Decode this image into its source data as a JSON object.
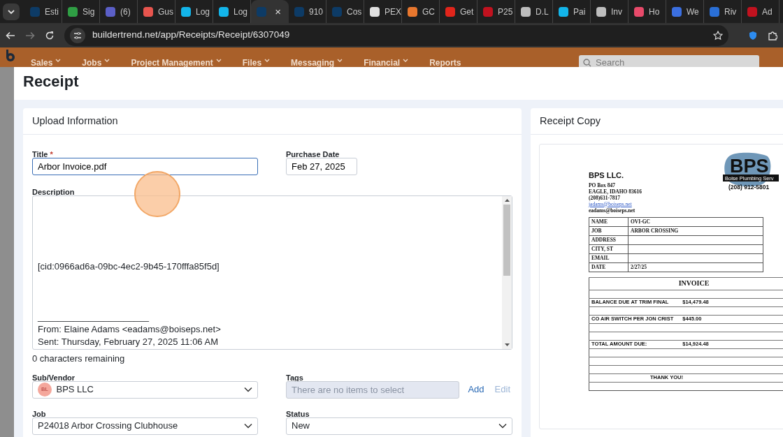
{
  "browser": {
    "tabs": [
      {
        "title": "Esti",
        "color": "#0d3b66",
        "selected": false
      },
      {
        "title": "Sig",
        "color": "#2f9e44",
        "selected": false
      },
      {
        "title": "(6)",
        "color": "#5b5fc7",
        "selected": false
      },
      {
        "title": "Gus",
        "color": "#e8554e",
        "selected": false
      },
      {
        "title": "Log",
        "color": "#13b5ea",
        "selected": false
      },
      {
        "title": "Log",
        "color": "#13b5ea",
        "selected": false
      },
      {
        "close": "×",
        "color": "#0d3b66",
        "selected": true
      },
      {
        "title": "910",
        "color": "#0d3b66",
        "selected": false
      },
      {
        "title": "Cos",
        "color": "#0d3b66",
        "selected": false
      },
      {
        "title": "PEX",
        "color": "#e0e0e0",
        "selected": false
      },
      {
        "title": "GC",
        "color": "#e8772e",
        "selected": false
      },
      {
        "title": "Get",
        "color": "#e1251b",
        "selected": false
      },
      {
        "title": "P25",
        "color": "#c1121f",
        "selected": false
      },
      {
        "title": "D.L",
        "color": "#bdbdbd",
        "selected": false
      },
      {
        "title": "Pai",
        "color": "#13b5ea",
        "selected": false
      },
      {
        "title": "Inv",
        "color": "#bdbdbd",
        "selected": false
      },
      {
        "title": "Ho",
        "color": "#e84a6a",
        "selected": false
      },
      {
        "title": "We",
        "color": "#3b6fe0",
        "selected": false
      },
      {
        "title": "Riv",
        "color": "#2a6fd6",
        "selected": false
      },
      {
        "title": "Ad",
        "color": "#c1121f",
        "selected": false
      }
    ],
    "url": "buildertrend.net/app/Receipts/Receipt/6307049"
  },
  "app_nav": {
    "items": [
      "Sales",
      "Jobs",
      "Project Management",
      "Files",
      "Messaging",
      "Financial",
      "Reports"
    ],
    "search_placeholder": "Search"
  },
  "modal": {
    "title": "Receipt",
    "upload": {
      "heading": "Upload Information",
      "title_field": {
        "label": "Title",
        "required_mark": "*",
        "value": "Arbor Invoice.pdf",
        "focused": true
      },
      "purchase_date": {
        "label": "Purchase Date",
        "value": "Feb 27, 2025"
      },
      "description": {
        "label": "Description",
        "value": "\n\n\n\n\n[cid:0966ad6a-09bc-4ec2-9b45-170fffa85f5d]\n\n\n\n______________________\nFrom: Elaine Adams <eadams@boiseps.net>\nSent: Thursday, February 27, 2025 11:06 AM"
      },
      "characters_remaining": "0 characters remaining",
      "sub_vendor": {
        "label": "Sub/Vendor",
        "avatar": "BL",
        "value": "BPS LLC"
      },
      "tags": {
        "label": "Tags",
        "placeholder": "There are no items to select",
        "add": "Add",
        "edit": "Edit",
        "edit_disabled": true
      },
      "job": {
        "label": "Job",
        "value": "P24018 Arbor Crossing Clubhouse"
      },
      "status": {
        "label": "Status",
        "value": "New"
      }
    },
    "receipt_copy": {
      "heading": "Receipt Copy",
      "document": {
        "logo": {
          "text": "BPS",
          "band": "Boise Plumbing Serv",
          "phone": "(208) 912-5801"
        },
        "company": "BPS LLC.",
        "address_lines": [
          "PO Box 847",
          "EAGLE, IDAHO 83616",
          "(208)631-7817"
        ],
        "link": "jadams@boiseps.net",
        "email": "eadams@boiseps.net",
        "info_rows": [
          {
            "label": "NAME",
            "value": "OVI-GC"
          },
          {
            "label": "JOB",
            "value": "ARBOR CROSSING"
          },
          {
            "label": "ADDRESS"
          },
          {
            "label": "CITY, ST"
          },
          {
            "label": "EMAIL"
          },
          {
            "label": "DATE",
            "value": "2/27/25"
          }
        ],
        "invoice": {
          "title": "INVOICE",
          "rows": [
            {
              "kind": "blank"
            },
            {
              "kind": "item",
              "label": "BALANCE DUE AT TRIM FINAL",
              "amount": "$14,479.48"
            },
            {
              "kind": "blank"
            },
            {
              "kind": "item",
              "label": "CO AIR SWITCH PER JON CRIST",
              "amount": "$445.00"
            },
            {
              "kind": "blank"
            },
            {
              "kind": "blank"
            },
            {
              "kind": "item",
              "label": "TOTAL AMOUNT DUE:",
              "amount": "$14,924.48"
            },
            {
              "kind": "blank"
            },
            {
              "kind": "blank"
            },
            {
              "kind": "blank"
            },
            {
              "kind": "note",
              "text": "THANK YOU!"
            },
            {
              "kind": "blank"
            }
          ]
        }
      }
    }
  }
}
